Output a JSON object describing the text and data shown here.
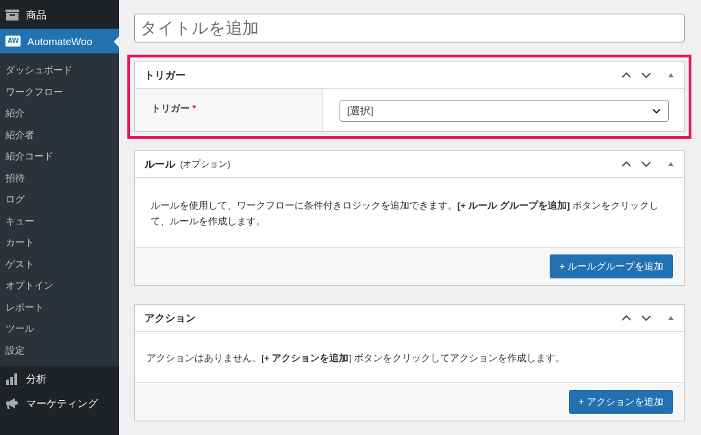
{
  "sidebar": {
    "items": [
      {
        "label": "商品",
        "kind": "box",
        "selected": false
      },
      {
        "label": "AutomateWoo",
        "kind": "logo",
        "logo_text": "AW",
        "selected": true,
        "children": [
          {
            "label": "ダッシュボード",
            "selected": false
          },
          {
            "label": "ワークフロー",
            "selected": false
          },
          {
            "label": "紹介",
            "selected": false
          },
          {
            "label": "紹介者",
            "selected": false
          },
          {
            "label": "紹介コード",
            "selected": false
          },
          {
            "label": "招待",
            "selected": false
          },
          {
            "label": "ログ",
            "selected": false
          },
          {
            "label": "キュー",
            "selected": false
          },
          {
            "label": "カート",
            "selected": false
          },
          {
            "label": "ゲスト",
            "selected": false
          },
          {
            "label": "オプトイン",
            "selected": false
          },
          {
            "label": "レポート",
            "selected": false
          },
          {
            "label": "ツール",
            "selected": false
          },
          {
            "label": "設定",
            "selected": false
          }
        ]
      },
      {
        "label": "分析",
        "kind": "chart",
        "selected": false
      },
      {
        "label": "マーケティング",
        "kind": "megaphone",
        "selected": false
      }
    ]
  },
  "title_field": {
    "placeholder": "タイトルを追加"
  },
  "panels": [
    {
      "kind": "trigger",
      "title": "トリガー",
      "highlighted": true,
      "fields": [
        {
          "label": "トリガー",
          "required_mark": "*",
          "value": "[選択]"
        }
      ]
    },
    {
      "kind": "rules",
      "title": "ルール",
      "subtitle": "(オプション)",
      "highlighted": false,
      "description": "ルールを使用して、ワークフローに条件付きロジックを追加できます。**[+ ルール グループを追加]** ボタンをクリックして、ルールを作成します。",
      "button": "+ ルールグループを追加"
    },
    {
      "kind": "actions",
      "title": "アクション",
      "highlighted": false,
      "description": "アクションはありません。[**+ アクションを追加**] ボタンをクリックしてアクションを作成します。",
      "button": "+ アクションを追加"
    }
  ]
}
